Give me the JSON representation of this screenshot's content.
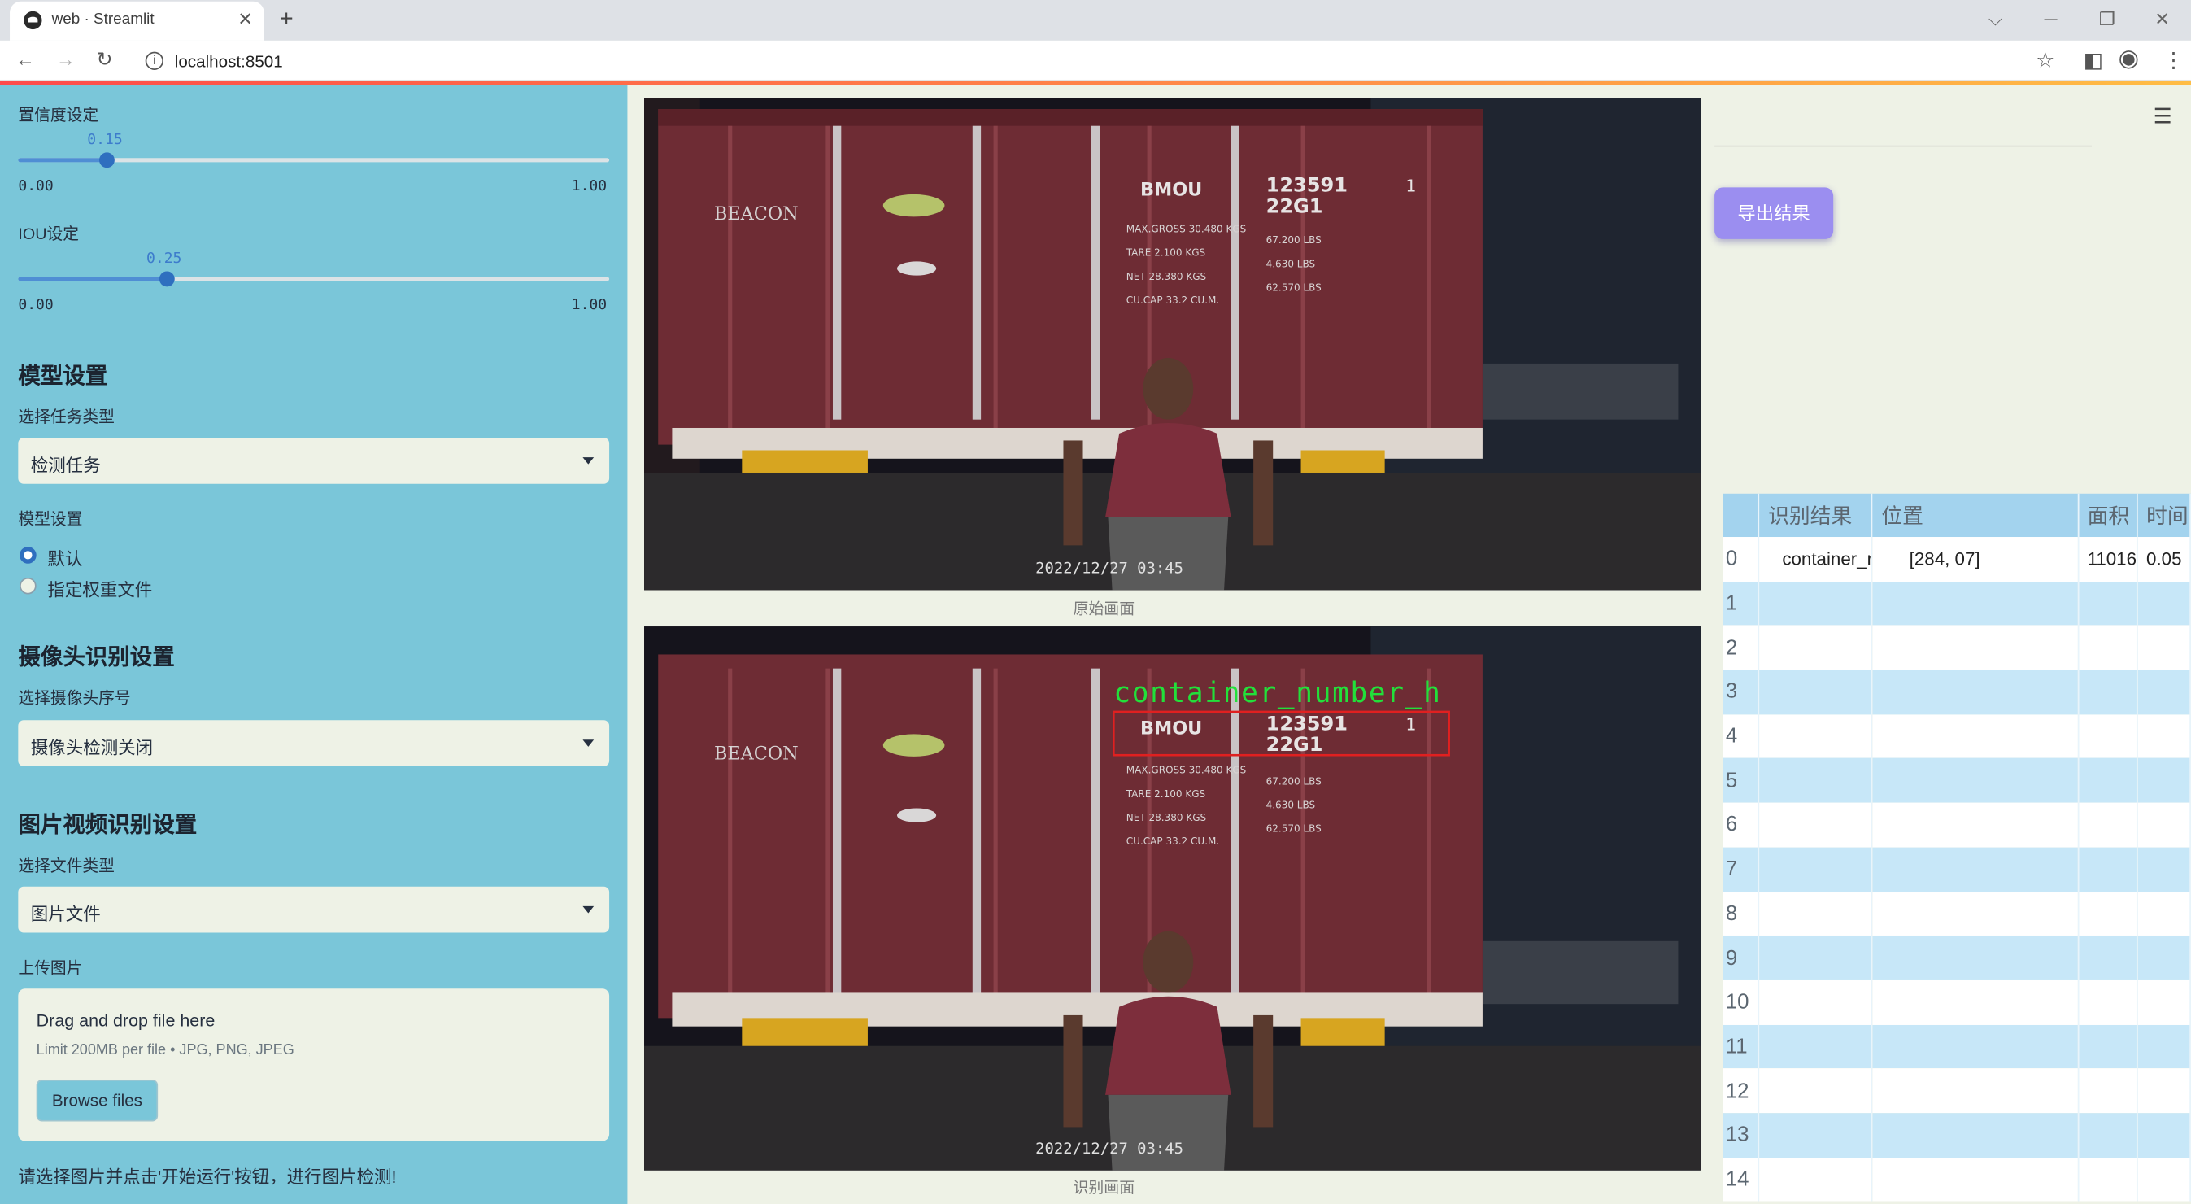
{
  "browser": {
    "tab_title": "web · Streamlit",
    "url": "localhost:8501"
  },
  "sidebar": {
    "conf_label": "置信度设定",
    "conf_value": "0.15",
    "conf_fraction": 0.15,
    "conf_min": "0.00",
    "conf_max": "1.00",
    "iou_label": "IOU设定",
    "iou_value": "0.25",
    "iou_fraction": 0.25,
    "iou_min": "0.00",
    "iou_max": "1.00",
    "model_header": "模型设置",
    "task_label": "选择任务类型",
    "task_value": "检测任务",
    "model_label": "模型设置",
    "model_options": [
      "默认",
      "指定权重文件"
    ],
    "model_selected": 0,
    "camera_header": "摄像头识别设置",
    "camera_label": "选择摄像头序号",
    "camera_value": "摄像头检测关闭",
    "file_header": "图片视频识别设置",
    "filetype_label": "选择文件类型",
    "filetype_value": "图片文件",
    "upload_label": "上传图片",
    "upload_title": "Drag and drop file here",
    "upload_limit": "Limit 200MB per file • JPG, PNG, JPEG",
    "browse_label": "Browse files",
    "hint": "请选择图片并点击'开始运行'按钮，进行图片检测!"
  },
  "main": {
    "original_caption": "原始画面",
    "result_caption": "识别画面",
    "detection_label": "container_number_h",
    "timestamp": "2022/12/27 03:45",
    "container_text": {
      "brand": "BEACON",
      "prefix": "BMOU",
      "number": "123591",
      "check": "1",
      "type": "22G1",
      "rows": [
        "MAX.GROSS  30.480 KGS",
        "67.200 LBS",
        "TARE  2.100 KGS",
        "4.630 LBS",
        "NET  28.380 KGS",
        "62.570 LBS",
        "CU.CAP  33.2 CU.M."
      ]
    },
    "export_label": "导出结果"
  },
  "table": {
    "headers": [
      "",
      "识别结果",
      "位置",
      "面积",
      "时间"
    ],
    "rows": [
      {
        "idx": "0",
        "result": "container_number_h",
        "position": "[284, 07]",
        "area": "11016",
        "time": "0.05"
      },
      {
        "idx": "1",
        "result": "",
        "position": "",
        "area": "",
        "time": ""
      },
      {
        "idx": "2",
        "result": "",
        "position": "",
        "area": "",
        "time": ""
      },
      {
        "idx": "3",
        "result": "",
        "position": "",
        "area": "",
        "time": ""
      },
      {
        "idx": "4",
        "result": "",
        "position": "",
        "area": "",
        "time": ""
      },
      {
        "idx": "5",
        "result": "",
        "position": "",
        "area": "",
        "time": ""
      },
      {
        "idx": "6",
        "result": "",
        "position": "",
        "area": "",
        "time": ""
      },
      {
        "idx": "7",
        "result": "",
        "position": "",
        "area": "",
        "time": ""
      },
      {
        "idx": "8",
        "result": "",
        "position": "",
        "area": "",
        "time": ""
      },
      {
        "idx": "9",
        "result": "",
        "position": "",
        "area": "",
        "time": ""
      },
      {
        "idx": "10",
        "result": "",
        "position": "",
        "area": "",
        "time": ""
      },
      {
        "idx": "11",
        "result": "",
        "position": "",
        "area": "",
        "time": ""
      },
      {
        "idx": "12",
        "result": "",
        "position": "",
        "area": "",
        "time": ""
      },
      {
        "idx": "13",
        "result": "",
        "position": "",
        "area": "",
        "time": ""
      },
      {
        "idx": "14",
        "result": "",
        "position": "",
        "area": "",
        "time": ""
      }
    ]
  },
  "colors": {
    "sidebar_bg": "#7ac6d9",
    "accent": "#2f6fbf",
    "export_button": "#9b8ef0",
    "detection_box": "#e02020",
    "detection_text": "#22e03a",
    "table_header": "#a3d3ee",
    "table_stripe": "#c7e7f8"
  }
}
